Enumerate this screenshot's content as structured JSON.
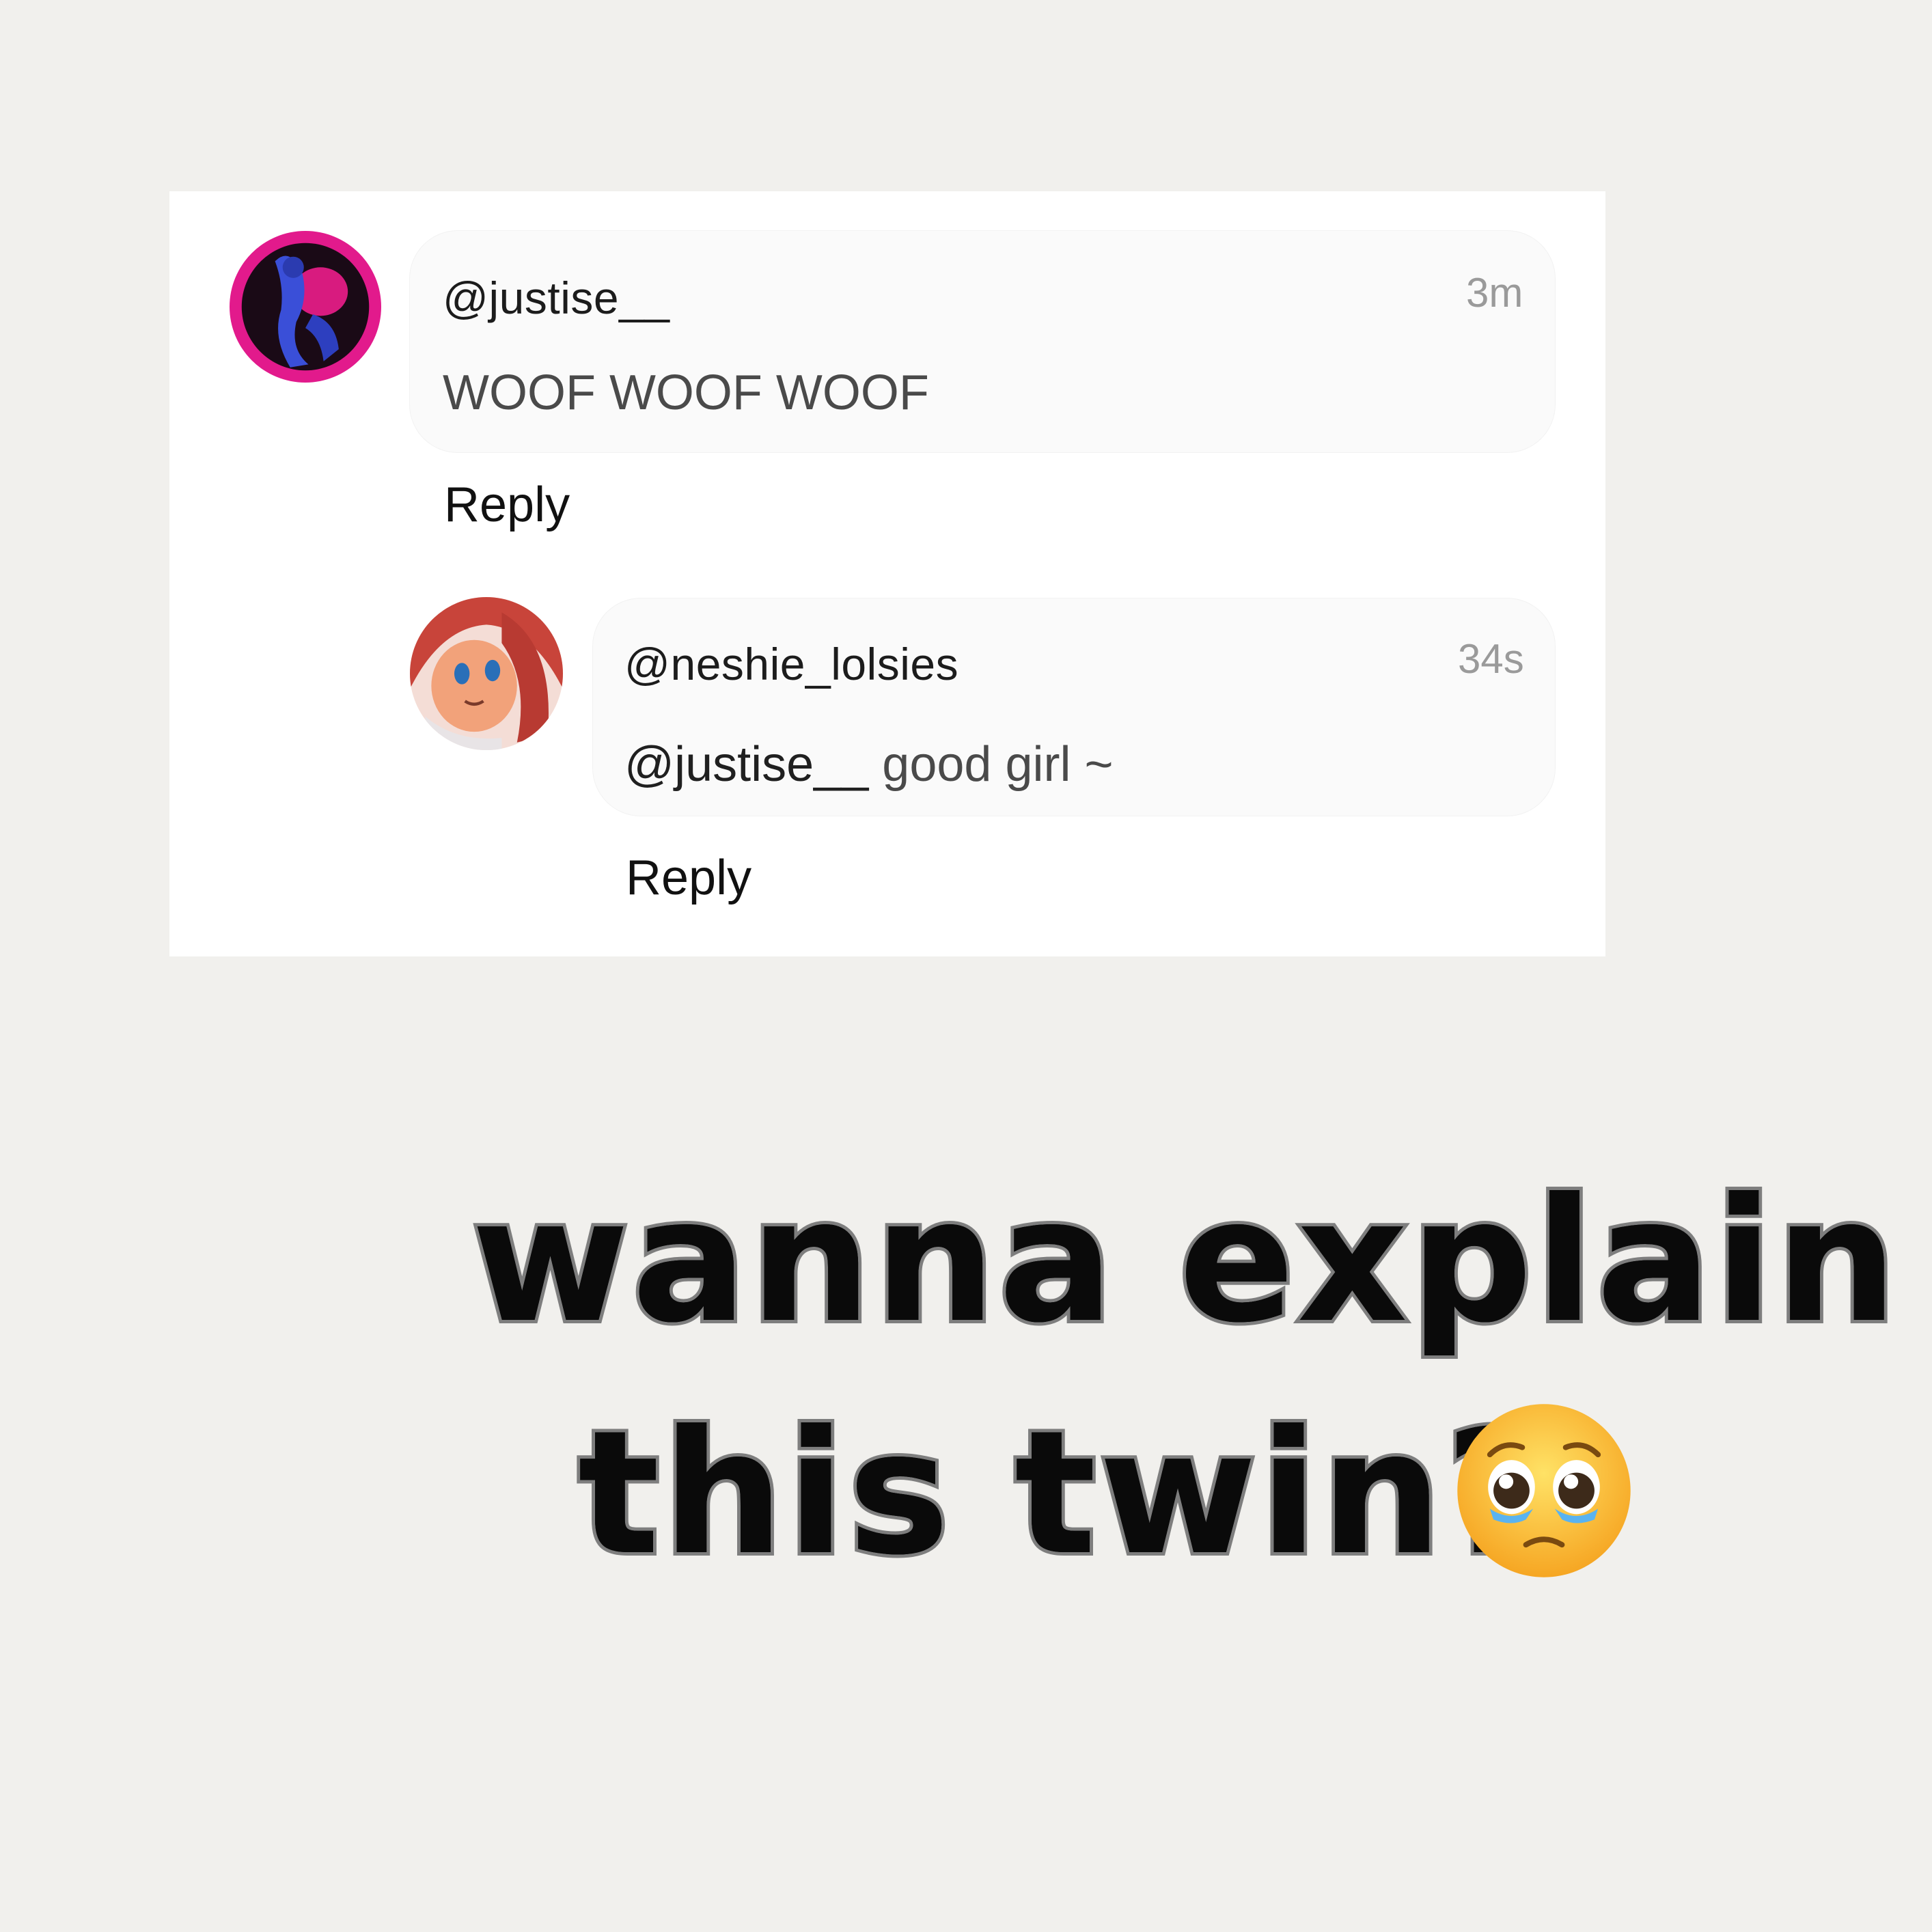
{
  "comments": [
    {
      "username": "@justise__",
      "time": "3m",
      "text": "WOOF WOOF WOOF",
      "reply_label": "Reply"
    },
    {
      "username": "@neshie_lolsies",
      "time": "34s",
      "mention": "@justise__",
      "text": " good girl ~",
      "reply_label": "Reply"
    }
  ],
  "caption": {
    "line1": "wanna explain",
    "line2": "this twin?"
  },
  "icons": {
    "emoji": "pleading-face-icon"
  }
}
